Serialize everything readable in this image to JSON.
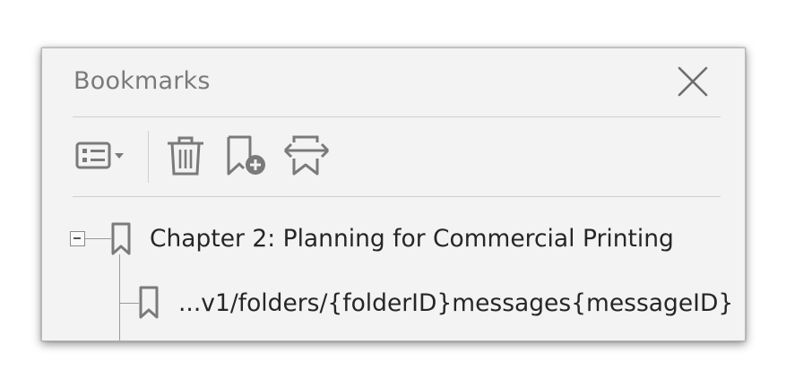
{
  "panel": {
    "title": "Bookmarks"
  },
  "toolbar": {
    "items": [
      {
        "name": "options-menu",
        "icon": "list-options-icon"
      },
      {
        "name": "delete-bookmark",
        "icon": "trash-icon"
      },
      {
        "name": "new-bookmark",
        "icon": "add-bookmark-icon"
      },
      {
        "name": "expand-bookmark",
        "icon": "expand-bookmark-icon"
      }
    ]
  },
  "bookmarks": [
    {
      "label": "Chapter 2: Planning for Commercial Printing",
      "expanded": true,
      "children": [
        {
          "label": "...v1/folders/{folderID}messages{messageID}"
        }
      ]
    }
  ],
  "colors": {
    "panel_bg": "#f3f3f3",
    "icon": "#7a7a7a",
    "title": "#7a7a7a",
    "text": "#262626"
  }
}
